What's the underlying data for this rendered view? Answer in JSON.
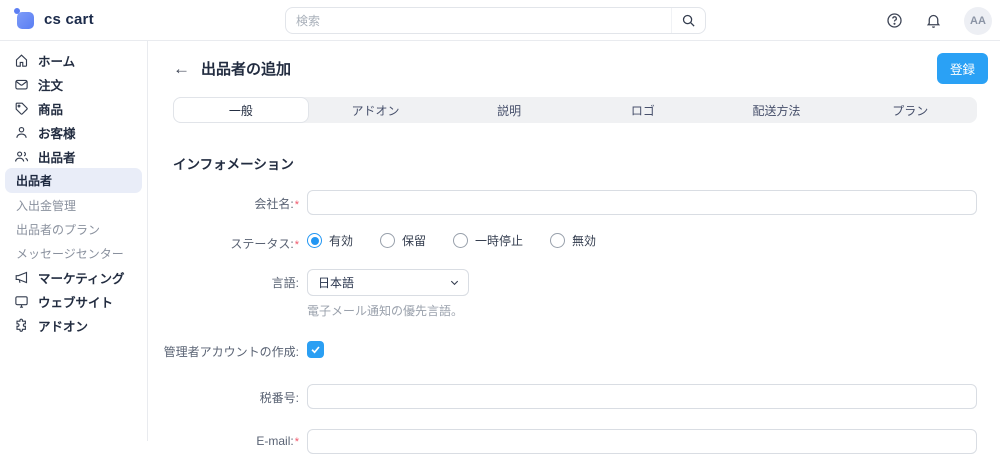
{
  "brand": {
    "name": "cs cart"
  },
  "topbar": {
    "search_placeholder": "検索",
    "avatar_initials": "AA"
  },
  "sidebar": {
    "items": [
      {
        "label": "ホーム",
        "icon": "home"
      },
      {
        "label": "注文",
        "icon": "orders"
      },
      {
        "label": "商品",
        "icon": "products"
      },
      {
        "label": "お客様",
        "icon": "customers"
      },
      {
        "label": "出品者",
        "icon": "vendors"
      }
    ],
    "subitems": [
      {
        "label": "出品者",
        "active": true
      },
      {
        "label": "入出金管理",
        "active": false
      },
      {
        "label": "出品者のプラン",
        "active": false
      },
      {
        "label": "メッセージセンター",
        "active": false
      }
    ],
    "items_bottom": [
      {
        "label": "マーケティング",
        "icon": "marketing"
      },
      {
        "label": "ウェブサイト",
        "icon": "website"
      },
      {
        "label": "アドオン",
        "icon": "addons"
      }
    ]
  },
  "header": {
    "title": "出品者の追加",
    "register_label": "登録"
  },
  "tabs": [
    {
      "label": "一般",
      "active": true
    },
    {
      "label": "アドオン",
      "active": false
    },
    {
      "label": "説明",
      "active": false
    },
    {
      "label": "ロゴ",
      "active": false
    },
    {
      "label": "配送方法",
      "active": false
    },
    {
      "label": "プラン",
      "active": false
    }
  ],
  "form": {
    "section_title": "インフォメーション",
    "required_mark": "*",
    "company": {
      "label": "会社名:",
      "required": true,
      "value": ""
    },
    "status": {
      "label": "ステータス:",
      "required": true,
      "options": [
        {
          "label": "有効",
          "selected": true
        },
        {
          "label": "保留",
          "selected": false
        },
        {
          "label": "一時停止",
          "selected": false
        },
        {
          "label": "無効",
          "selected": false
        }
      ]
    },
    "language": {
      "label": "言語:",
      "value": "日本語",
      "hint": "電子メール通知の優先言語。"
    },
    "admin_account": {
      "label": "管理者アカウントの作成:",
      "checked": true
    },
    "tax": {
      "label": "税番号:",
      "value": ""
    },
    "email": {
      "label": "E-mail:",
      "required": true,
      "value": ""
    }
  },
  "colors": {
    "accent": "#2aa1f5",
    "sidebar_active_bg": "#e9edf8",
    "logo_blue": "#5c7ef3"
  }
}
